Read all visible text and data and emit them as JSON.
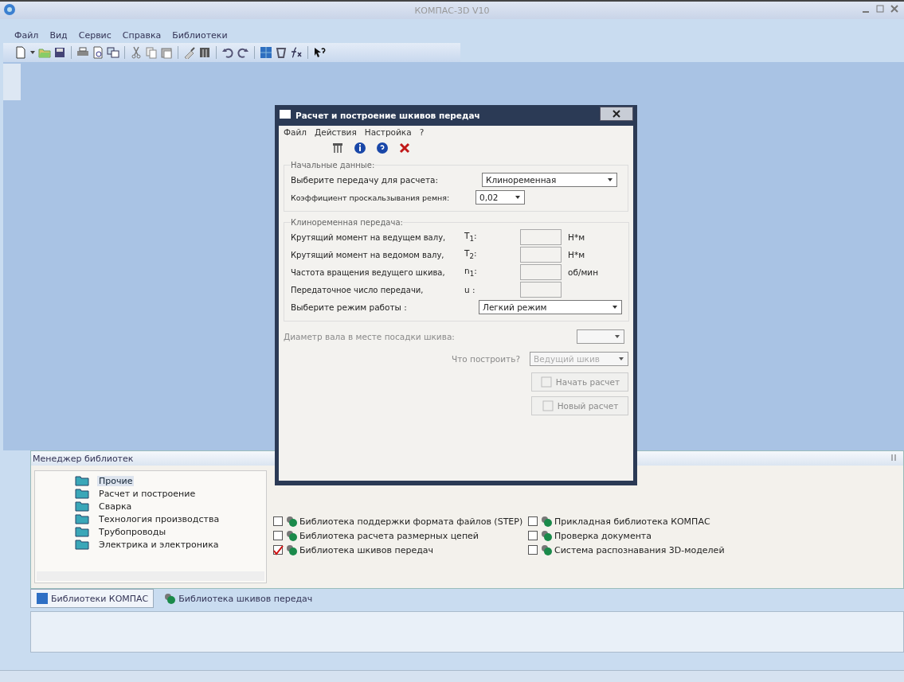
{
  "window": {
    "title": "КОМПАС-3D V10"
  },
  "menu": [
    "Файл",
    "Вид",
    "Сервис",
    "Справка",
    "Библиотеки"
  ],
  "dialog": {
    "title": "Расчет и построение шкивов передач",
    "menu": [
      "Файл",
      "Действия",
      "Настройка",
      "?"
    ],
    "initial_group": {
      "title": "Начальные данные:",
      "fields": [
        {
          "label": "Выберите передачу для расчета:",
          "value": "Клиноременная",
          "kind": "wide"
        },
        {
          "label": "Коэффициент проскальзывания ремня:",
          "value": "0,02",
          "kind": "narrow"
        }
      ]
    },
    "belt_group": {
      "title": "Клиноременная передача:",
      "rows": [
        {
          "label": "Крутящий момент на ведущем валу,",
          "symbol": "T$_{1}$:",
          "unit": "Н*м"
        },
        {
          "label": "Крутящий момент на ведомом валу,",
          "symbol": "T$_{2}$:",
          "unit": "Н*м"
        },
        {
          "label": "Частота вращения ведущего шкива,",
          "symbol": "n$_{1}$:",
          "unit": "об/мин"
        },
        {
          "label": "Передаточное число передачи,",
          "symbol": "u :"
        }
      ],
      "mode": {
        "label": "Выберите режим работы :",
        "value": "Легкий режим"
      }
    },
    "shaft": {
      "label": "Диаметр вала в месте посадки шкива:",
      "disabled": true
    },
    "build": {
      "label": "Что построить?",
      "value": "Ведущий шкив",
      "disabled": true
    },
    "buttons": [
      {
        "label": "Начать расчет",
        "disabled": true
      },
      {
        "label": "Новый расчет",
        "disabled": true
      }
    ]
  },
  "library_manager": {
    "title": "Менеджер библиотек",
    "tree": [
      {
        "label": "Прочие",
        "selected": true
      },
      {
        "label": "Расчет и построение",
        "selected": false
      },
      {
        "label": "Сварка",
        "selected": false
      },
      {
        "label": "Технология производства",
        "selected": false
      },
      {
        "label": "Трубопроводы",
        "selected": false
      },
      {
        "label": "Электрика и электроника",
        "selected": false
      }
    ],
    "libraries": [
      {
        "label": "Библиотека поддержки формата файлов (STEP)",
        "checked": false
      },
      {
        "label": "Прикладная библиотека КОМПАС",
        "checked": false
      },
      {
        "label": "Библиотека расчета размерных цепей",
        "checked": false
      },
      {
        "label": "Проверка документа",
        "checked": false
      },
      {
        "label": "Библиотека шкивов передач",
        "checked": true
      },
      {
        "label": "Система распознавания 3D-моделей",
        "checked": false
      }
    ],
    "tabs": [
      {
        "label": "Библиотеки КОМПАС",
        "selected": true
      },
      {
        "label": "Библиотека шкивов передач",
        "selected": false
      }
    ]
  }
}
